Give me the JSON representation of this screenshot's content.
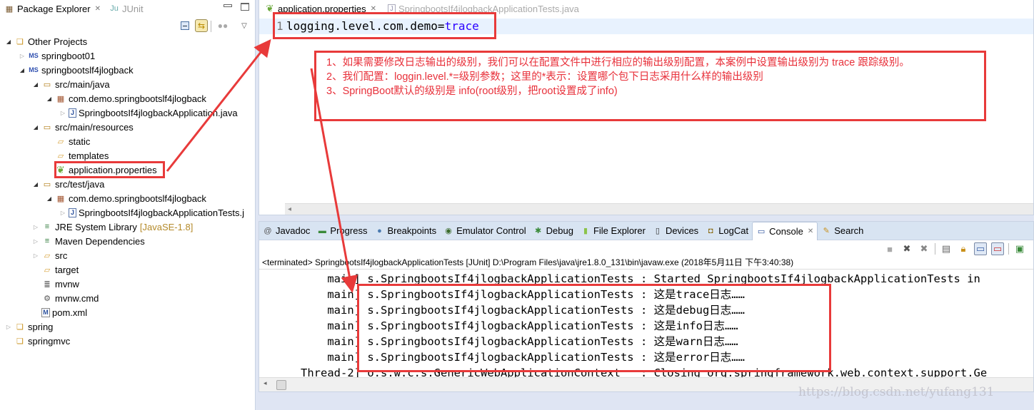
{
  "package_explorer": {
    "tabs": [
      {
        "label": "Package Explorer",
        "active": true,
        "icon": "package-explorer-icon"
      },
      {
        "label": "JUnit",
        "active": false,
        "icon": "junit-icon"
      }
    ],
    "tree": [
      {
        "label": "Other Projects",
        "depth": 0,
        "twisty": "open",
        "icon": "working-set-icon"
      },
      {
        "label": "springboot01",
        "depth": 1,
        "twisty": "closed",
        "icon": "spring-maven-project-icon"
      },
      {
        "label": "springbootslf4jlogback",
        "depth": 1,
        "twisty": "open",
        "icon": "spring-maven-project-icon"
      },
      {
        "label": "src/main/java",
        "depth": 2,
        "twisty": "open",
        "icon": "source-folder-icon"
      },
      {
        "label": "com.demo.springbootslf4jlogback",
        "depth": 3,
        "twisty": "open",
        "icon": "package-icon"
      },
      {
        "label": "SpringbootsIf4jlogbackApplication.java",
        "depth": 4,
        "twisty": "closed",
        "icon": "java-file-icon"
      },
      {
        "label": "src/main/resources",
        "depth": 2,
        "twisty": "open",
        "icon": "source-folder-icon"
      },
      {
        "label": "static",
        "depth": 3,
        "twisty": "none",
        "icon": "folder-icon"
      },
      {
        "label": "templates",
        "depth": 3,
        "twisty": "none",
        "icon": "folder-icon"
      },
      {
        "label": "application.properties",
        "depth": 3,
        "twisty": "none",
        "icon": "spring-properties-icon"
      },
      {
        "label": "src/test/java",
        "depth": 2,
        "twisty": "open",
        "icon": "source-folder-icon"
      },
      {
        "label": "com.demo.springbootslf4jlogback",
        "depth": 3,
        "twisty": "open",
        "icon": "package-icon"
      },
      {
        "label": "SpringbootsIf4jlogbackApplicationTests.j",
        "depth": 4,
        "twisty": "closed",
        "icon": "java-file-icon"
      },
      {
        "label": "JRE System Library",
        "decoration": "[JavaSE-1.8]",
        "depth": 2,
        "twisty": "closed",
        "icon": "library-icon"
      },
      {
        "label": "Maven Dependencies",
        "depth": 2,
        "twisty": "closed",
        "icon": "library-icon"
      },
      {
        "label": "src",
        "depth": 2,
        "twisty": "closed",
        "icon": "folder-icon"
      },
      {
        "label": "target",
        "depth": 2,
        "twisty": "none",
        "icon": "folder-icon"
      },
      {
        "label": "mvnw",
        "depth": 2,
        "twisty": "none",
        "icon": "text-file-icon"
      },
      {
        "label": "mvnw.cmd",
        "depth": 2,
        "twisty": "none",
        "icon": "cmd-file-icon"
      },
      {
        "label": "pom.xml",
        "depth": 2,
        "twisty": "none",
        "icon": "maven-pom-icon"
      },
      {
        "label": "spring",
        "depth": 0,
        "twisty": "closed",
        "icon": "working-set-icon"
      },
      {
        "label": "springmvc",
        "depth": 0,
        "twisty": "none",
        "icon": "working-set-icon"
      }
    ]
  },
  "editor": {
    "tabs": [
      {
        "label": "application.properties",
        "active": true
      },
      {
        "label": "SpringbootsIf4jlogbackApplicationTests.java",
        "active": false
      }
    ],
    "line_number": "1",
    "code_key": "logging.level.com.demo=",
    "code_value": "trace"
  },
  "annotation": {
    "lines": [
      "1、如果需要修改日志输出的级别，我们可以在配置文件中进行相应的输出级别配置，本案例中设置输出级别为 trace 跟踪级别。",
      "2、我们配置：loggin.level.*=级别参数；这里的*表示：设置哪个包下日志采用什么样的输出级别",
      "3、SpringBoot默认的级别是 info(root级别，把root设置成了info)"
    ],
    "color": "#e8303a"
  },
  "console": {
    "tabs": [
      {
        "label": "Javadoc",
        "icon": "javadoc-icon",
        "active": false
      },
      {
        "label": "Progress",
        "icon": "progress-icon",
        "active": false
      },
      {
        "label": "Breakpoints",
        "icon": "breakpoints-icon",
        "active": false
      },
      {
        "label": "Emulator Control",
        "icon": "emulator-control-icon",
        "active": false
      },
      {
        "label": "Debug",
        "icon": "debug-icon",
        "active": false
      },
      {
        "label": "File Explorer",
        "icon": "android-icon",
        "active": false
      },
      {
        "label": "Devices",
        "icon": "devices-icon",
        "active": false
      },
      {
        "label": "LogCat",
        "icon": "logcat-icon",
        "active": false
      },
      {
        "label": "Console",
        "icon": "console-icon",
        "active": true
      },
      {
        "label": "Search",
        "icon": "search-icon",
        "active": false
      }
    ],
    "status": "<terminated> SpringbootsIf4jlogbackApplicationTests [JUnit] D:\\Program Files\\java\\jre1.8.0_131\\bin\\javaw.exe (2018年5月11日 下午3:40:38)",
    "lines": [
      {
        "thread": "main]",
        "logger": "s.SpringbootsIf4jlogbackApplicationTests",
        "message": "Started SpringbootsIf4jlogbackApplicationTests in"
      },
      {
        "thread": "main]",
        "logger": "s.SpringbootsIf4jlogbackApplicationTests",
        "message": "这是trace日志……"
      },
      {
        "thread": "main]",
        "logger": "s.SpringbootsIf4jlogbackApplicationTests",
        "message": "这是debug日志……"
      },
      {
        "thread": "main]",
        "logger": "s.SpringbootsIf4jlogbackApplicationTests",
        "message": "这是info日志……"
      },
      {
        "thread": "main]",
        "logger": "s.SpringbootsIf4jlogbackApplicationTests",
        "message": "这是warn日志……"
      },
      {
        "thread": "main]",
        "logger": "s.SpringbootsIf4jlogbackApplicationTests",
        "message": "这是error日志……"
      },
      {
        "thread": "Thread-2]",
        "logger": "o.s.w.c.s.GenericWebApplicationContext  ",
        "message": "Closing org.springframework.web.context.support.Ge"
      }
    ]
  },
  "watermark": "https://blog.csdn.net/yufang131",
  "colors": {
    "highlight_red": "#e83a3a",
    "code_value_blue": "#2a00ff",
    "tab_bar_blue": "#d8e4f2"
  }
}
